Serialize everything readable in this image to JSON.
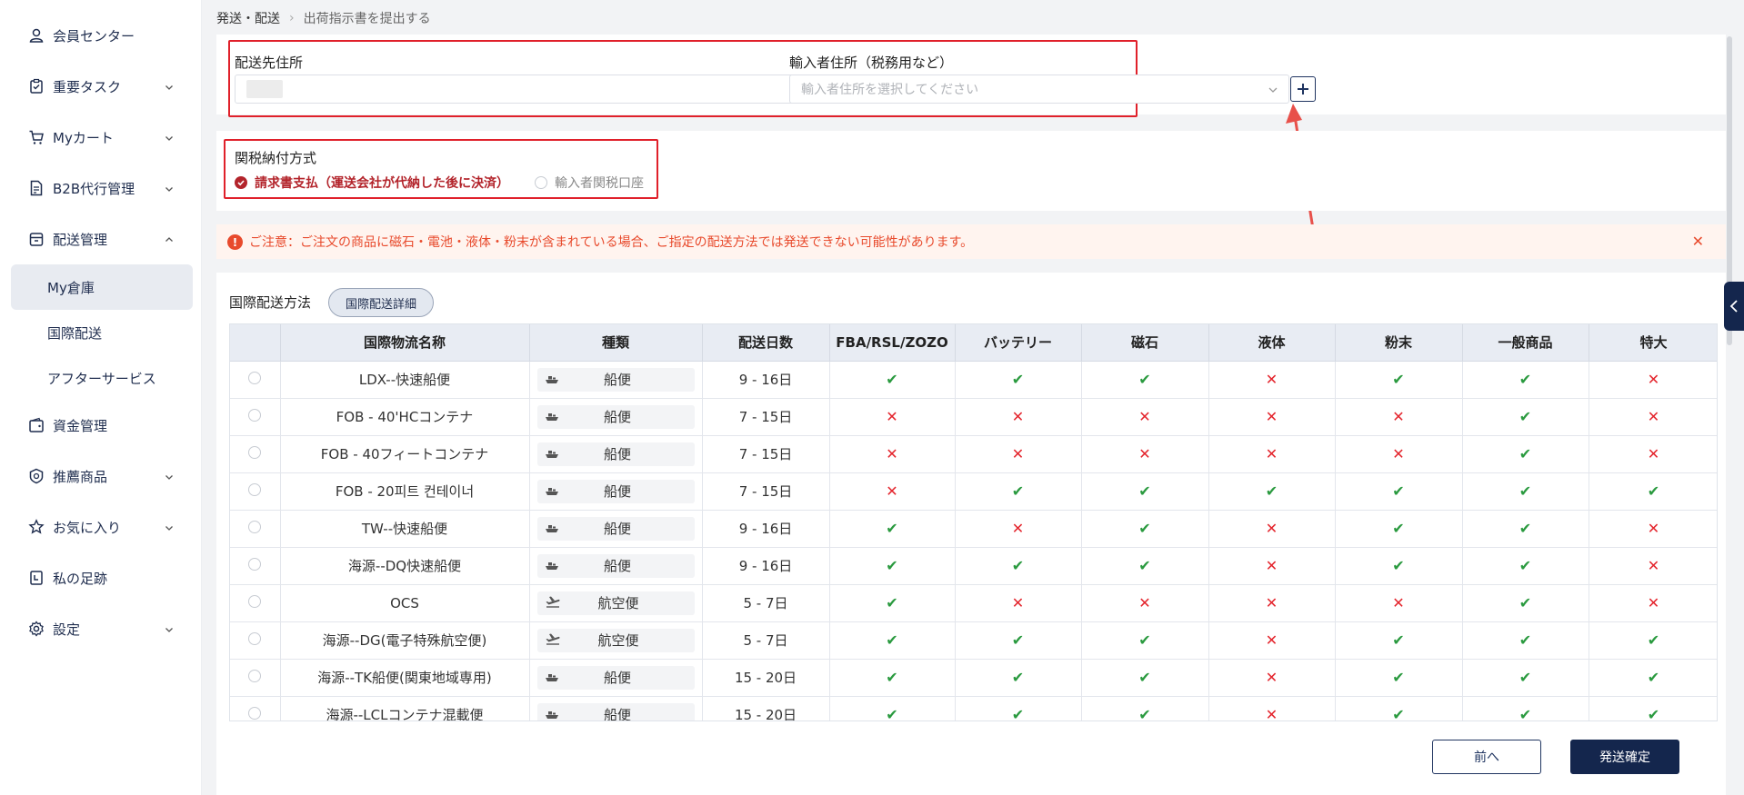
{
  "sidebar": {
    "items": [
      {
        "label": "会員センター",
        "icon": "user-icon",
        "has_chevron": false
      },
      {
        "label": "重要タスク",
        "icon": "task-icon",
        "has_chevron": true
      },
      {
        "label": "Myカート",
        "icon": "cart-icon",
        "has_chevron": true
      },
      {
        "label": "B2B代行管理",
        "icon": "document-icon",
        "has_chevron": true
      },
      {
        "label": "配送管理",
        "icon": "box-icon",
        "has_chevron": true,
        "expanded": true
      },
      {
        "label": "資金管理",
        "icon": "wallet-icon",
        "has_chevron": false
      },
      {
        "label": "推薦商品",
        "icon": "badge-icon",
        "has_chevron": true
      },
      {
        "label": "お気に入り",
        "icon": "star-icon",
        "has_chevron": true
      },
      {
        "label": "私の足跡",
        "icon": "history-icon",
        "has_chevron": false
      },
      {
        "label": "設定",
        "icon": "gear-icon",
        "has_chevron": true
      }
    ],
    "sub_items": [
      {
        "label": "My倉庫",
        "active": true
      },
      {
        "label": "国際配送",
        "active": false
      },
      {
        "label": "アフターサービス",
        "active": false
      }
    ]
  },
  "breadcrumb": {
    "parent": "発送・配送",
    "current": "出荷指示書を提出する"
  },
  "address": {
    "destination_label": "配送先住所",
    "importer_label": "輸入者住所（税務用など）",
    "importer_placeholder": "輸入者住所を選択してください"
  },
  "duty": {
    "label": "関税納付方式",
    "option_invoice": "請求書支払（運送会社が代納した後に決済）",
    "option_importer": "輸入者関税口座",
    "selected": "invoice"
  },
  "notice": {
    "text": "ご注意：ご注文の商品に磁石・電池・液体・粉末が含まれている場合、ご指定の配送方法では発送できない可能性があります。"
  },
  "shipping": {
    "section_label": "国際配送方法",
    "detail_button": "国際配送詳細",
    "columns": [
      "国際物流名称",
      "種類",
      "配送日数",
      "FBA/RSL/ZOZO",
      "バッテリー",
      "磁石",
      "液体",
      "粉末",
      "一般商品",
      "特大"
    ],
    "rows": [
      {
        "name": "LDX--快速船便",
        "type": "船便",
        "days": "9 - 16日",
        "flags": [
          1,
          1,
          1,
          0,
          1,
          1,
          0
        ]
      },
      {
        "name": "FOB - 40'HCコンテナ",
        "type": "船便",
        "days": "7 - 15日",
        "flags": [
          0,
          0,
          0,
          0,
          0,
          1,
          0
        ]
      },
      {
        "name": "FOB - 40フィートコンテナ",
        "type": "船便",
        "days": "7 - 15日",
        "flags": [
          0,
          0,
          0,
          0,
          0,
          1,
          0
        ]
      },
      {
        "name": "FOB - 20피트 컨테이너",
        "type": "船便",
        "days": "7 - 15日",
        "flags": [
          0,
          1,
          1,
          1,
          1,
          1,
          1
        ]
      },
      {
        "name": "TW--快速船便",
        "type": "船便",
        "days": "9 - 16日",
        "flags": [
          1,
          0,
          1,
          0,
          1,
          1,
          0
        ]
      },
      {
        "name": "海源--DQ快速船便",
        "type": "船便",
        "days": "9 - 16日",
        "flags": [
          1,
          1,
          1,
          0,
          1,
          1,
          0
        ]
      },
      {
        "name": "OCS",
        "type": "航空便",
        "days": "5 - 7日",
        "flags": [
          1,
          0,
          0,
          0,
          0,
          1,
          0
        ]
      },
      {
        "name": "海源--DG(電子特殊航空便)",
        "type": "航空便",
        "days": "5 - 7日",
        "flags": [
          1,
          1,
          1,
          0,
          1,
          1,
          1
        ]
      },
      {
        "name": "海源--TK船便(関東地域専用)",
        "type": "船便",
        "days": "15 - 20日",
        "flags": [
          1,
          1,
          1,
          0,
          1,
          1,
          1
        ]
      },
      {
        "name": "海源--LCLコンテナ混載便",
        "type": "船便",
        "days": "15 - 20日",
        "flags": [
          1,
          1,
          1,
          0,
          1,
          1,
          1
        ]
      }
    ]
  },
  "footer": {
    "prev_label": "前へ",
    "confirm_label": "発送確定"
  },
  "colors": {
    "primary": "#14264d",
    "red": "#e4252d",
    "green": "#2a9a3f",
    "notice_bg": "#fff4ef"
  }
}
